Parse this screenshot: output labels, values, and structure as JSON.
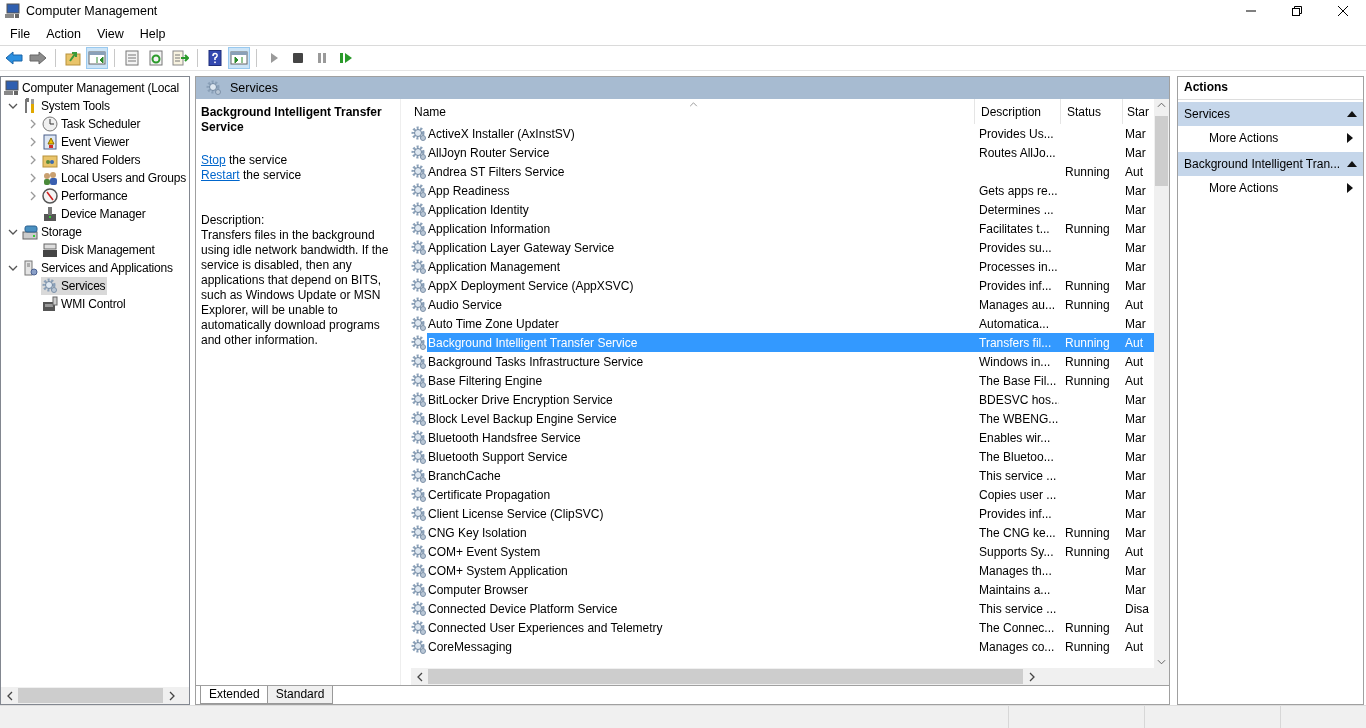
{
  "window": {
    "title": "Computer Management"
  },
  "menu": [
    "File",
    "Action",
    "View",
    "Help"
  ],
  "toolbar": [
    {
      "kind": "back",
      "pressed": false
    },
    {
      "kind": "forward",
      "pressed": false
    },
    {
      "kind": "sep"
    },
    {
      "kind": "up",
      "pressed": false
    },
    {
      "kind": "tree",
      "pressed": true
    },
    {
      "kind": "sep"
    },
    {
      "kind": "properties",
      "pressed": false
    },
    {
      "kind": "refresh",
      "pressed": false
    },
    {
      "kind": "export",
      "pressed": false
    },
    {
      "kind": "sep"
    },
    {
      "kind": "help",
      "pressed": false
    },
    {
      "kind": "actionpane",
      "pressed": true
    },
    {
      "kind": "sep"
    },
    {
      "kind": "play",
      "pressed": false
    },
    {
      "kind": "stop",
      "pressed": false
    },
    {
      "kind": "pause",
      "pressed": false
    },
    {
      "kind": "resume",
      "pressed": false
    }
  ],
  "tree": [
    {
      "label": "Computer Management (Local",
      "kind": "computer",
      "selected": false,
      "children": [
        {
          "label": "System Tools",
          "kind": "tools",
          "expanded": true,
          "selected": false,
          "children": [
            {
              "label": "Task Scheduler",
              "kind": "clock",
              "expanded": false,
              "selected": false
            },
            {
              "label": "Event Viewer",
              "kind": "log",
              "expanded": false,
              "selected": false
            },
            {
              "label": "Shared Folders",
              "kind": "folder",
              "expanded": false,
              "selected": false
            },
            {
              "label": "Local Users and Groups",
              "kind": "users",
              "expanded": false,
              "selected": false
            },
            {
              "label": "Performance",
              "kind": "gauge",
              "expanded": false,
              "selected": false
            },
            {
              "label": "Device Manager",
              "kind": "device",
              "selected": false
            }
          ]
        },
        {
          "label": "Storage",
          "kind": "storage",
          "expanded": true,
          "selected": false,
          "children": [
            {
              "label": "Disk Management",
              "kind": "disk",
              "selected": false
            }
          ]
        },
        {
          "label": "Services and Applications",
          "kind": "server",
          "expanded": true,
          "selected": false,
          "children": [
            {
              "label": "Services",
              "kind": "gear",
              "selected": true
            },
            {
              "label": "WMI Control",
              "kind": "wmi",
              "selected": false
            }
          ]
        }
      ]
    }
  ],
  "center": {
    "title": "Services",
    "details": {
      "title": "Background Intelligent Transfer Service",
      "actions": [
        {
          "link": "Stop",
          "text": "the service"
        },
        {
          "link": "Restart",
          "text": "the service"
        }
      ],
      "description_label": "Description:",
      "description": "Transfers files in the background using idle network bandwidth. If the service is disabled, then any applications that depend on BITS, such as Windows Update or MSN Explorer, will be unable to automatically download programs and other information."
    },
    "table": {
      "columns": [
        "Name",
        "Description",
        "Status",
        "Star"
      ],
      "rows": [
        {
          "name": "ActiveX Installer (AxInstSV)",
          "description": "Provides Us...",
          "startup": "Mar",
          "selected": false
        },
        {
          "name": "AllJoyn Router Service",
          "description": "Routes AllJo...",
          "startup": "Mar",
          "selected": false
        },
        {
          "name": "Andrea ST Filters Service",
          "status": "Running",
          "startup": "Aut",
          "selected": false
        },
        {
          "name": "App Readiness",
          "description": "Gets apps re...",
          "startup": "Mar",
          "selected": false
        },
        {
          "name": "Application Identity",
          "description": "Determines ...",
          "startup": "Mar",
          "selected": false
        },
        {
          "name": "Application Information",
          "description": "Facilitates t...",
          "status": "Running",
          "startup": "Mar",
          "selected": false
        },
        {
          "name": "Application Layer Gateway Service",
          "description": "Provides su...",
          "startup": "Mar",
          "selected": false
        },
        {
          "name": "Application Management",
          "description": "Processes in...",
          "startup": "Mar",
          "selected": false
        },
        {
          "name": "AppX Deployment Service (AppXSVC)",
          "description": "Provides inf...",
          "status": "Running",
          "startup": "Mar",
          "selected": false
        },
        {
          "name": "Audio Service",
          "description": "Manages au...",
          "status": "Running",
          "startup": "Aut",
          "selected": false
        },
        {
          "name": "Auto Time Zone Updater",
          "description": "Automatica...",
          "startup": "Mar",
          "selected": false
        },
        {
          "name": "Background Intelligent Transfer Service",
          "description": "Transfers fil...",
          "status": "Running",
          "startup": "Aut",
          "selected": true
        },
        {
          "name": "Background Tasks Infrastructure Service",
          "description": "Windows in...",
          "status": "Running",
          "startup": "Aut",
          "selected": false
        },
        {
          "name": "Base Filtering Engine",
          "description": "The Base Fil...",
          "status": "Running",
          "startup": "Aut",
          "selected": false
        },
        {
          "name": "BitLocker Drive Encryption Service",
          "description": "BDESVC hos...",
          "startup": "Mar",
          "selected": false
        },
        {
          "name": "Block Level Backup Engine Service",
          "description": "The WBENG...",
          "startup": "Mar",
          "selected": false
        },
        {
          "name": "Bluetooth Handsfree Service",
          "description": "Enables wir...",
          "startup": "Mar",
          "selected": false
        },
        {
          "name": "Bluetooth Support Service",
          "description": "The Bluetoo...",
          "startup": "Mar",
          "selected": false
        },
        {
          "name": "BranchCache",
          "description": "This service ...",
          "startup": "Mar",
          "selected": false
        },
        {
          "name": "Certificate Propagation",
          "description": "Copies user ...",
          "startup": "Mar",
          "selected": false
        },
        {
          "name": "Client License Service (ClipSVC)",
          "description": "Provides inf...",
          "startup": "Mar",
          "selected": false
        },
        {
          "name": "CNG Key Isolation",
          "description": "The CNG ke...",
          "status": "Running",
          "startup": "Mar",
          "selected": false
        },
        {
          "name": "COM+ Event System",
          "description": "Supports Sy...",
          "status": "Running",
          "startup": "Aut",
          "selected": false
        },
        {
          "name": "COM+ System Application",
          "description": "Manages th...",
          "startup": "Mar",
          "selected": false
        },
        {
          "name": "Computer Browser",
          "description": "Maintains a...",
          "startup": "Mar",
          "selected": false
        },
        {
          "name": "Connected Device Platform Service",
          "description": "This service ...",
          "startup": "Disa",
          "selected": false
        },
        {
          "name": "Connected User Experiences and Telemetry",
          "description": "The Connec...",
          "status": "Running",
          "startup": "Aut",
          "selected": false
        },
        {
          "name": "CoreMessaging",
          "description": "Manages co...",
          "status": "Running",
          "startup": "Aut",
          "selected": false
        }
      ]
    },
    "tabs": [
      {
        "label": "Extended",
        "selected": true
      },
      {
        "label": "Standard",
        "selected": false
      }
    ]
  },
  "actions": {
    "title": "Actions",
    "sections": [
      {
        "title": "Services",
        "expanded": true,
        "items": [
          "More Actions"
        ]
      },
      {
        "title": "Background Intelligent Tran...",
        "expanded": true,
        "items": [
          "More Actions"
        ]
      }
    ]
  }
}
